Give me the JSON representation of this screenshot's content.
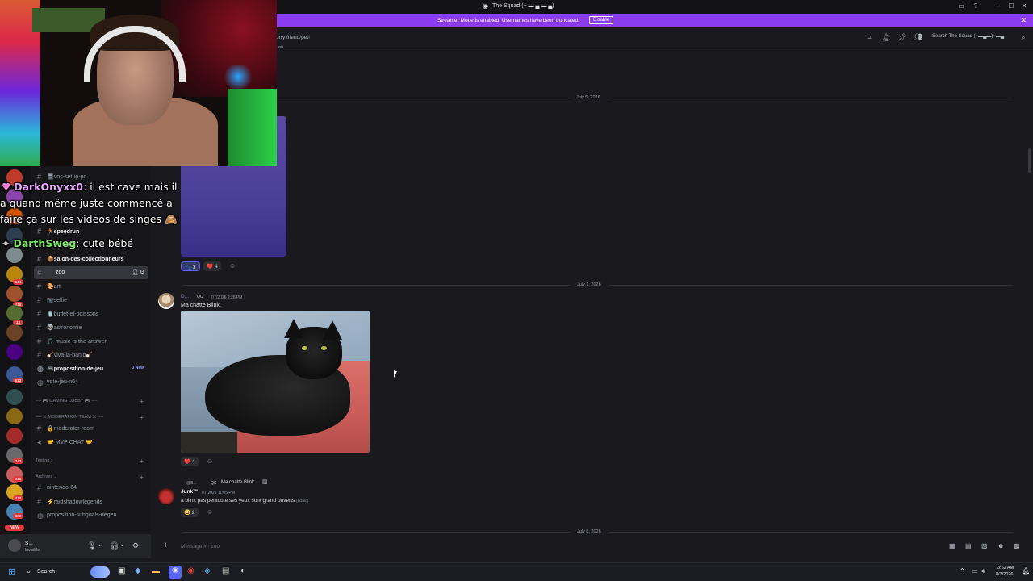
{
  "window": {
    "title": "The Squad (~ ▬ ▄ ▬ ▄)"
  },
  "banner": {
    "text": "Streamer Mode is enabled. Usernames have been truncated.",
    "disable_label": "Disable"
  },
  "header": {
    "topic": "urry friend/pet!",
    "search_placeholder": "Search The Squad (~▬▄▬)~▬▄"
  },
  "sidebar": {
    "channels_top": [
      {
        "name": "🖥vos-setup-pc"
      },
      {
        "name": "🏃speedrun",
        "bold": true
      },
      {
        "name": "📦salon-des-collectionneurs",
        "bold": true
      },
      {
        "name": "zoo",
        "active": true
      },
      {
        "name": "🎨art"
      },
      {
        "name": "📷selfie"
      },
      {
        "name": "🥤buffet-et-boissons"
      },
      {
        "name": "👽astronomie"
      },
      {
        "name": "🎵-music-is-the-answer"
      },
      {
        "name": "🪕viva-la-banjo🪕"
      },
      {
        "name": "🎮proposition-de-jeu",
        "bold": true,
        "badge": "3 New"
      },
      {
        "name": "vote-jeu-n64"
      }
    ],
    "cat_gaming": "---- 🎮 GAMING LOBBY 🎮 ----",
    "cat_moderation": "---- ⚔ MODERATION TEAM ⚔ ----",
    "moderation": [
      {
        "name": "🔒moderator-room"
      },
      {
        "name": "🤝 MVP CHAT 🤝"
      }
    ],
    "cat_testing": "Testing",
    "cat_archives": "Archives",
    "archives": [
      {
        "name": "nintendo-64"
      },
      {
        "name": "⚡raidshadowlegends"
      },
      {
        "name": "proposition-subgoals-degen"
      }
    ]
  },
  "rail_badges": [
    "644",
    "416",
    "18",
    "613",
    "343",
    "216",
    "429",
    "861"
  ],
  "rail_new": "NEW",
  "user": {
    "name": "S...",
    "status": "Invisible"
  },
  "chat": {
    "date1": "July 5, 2026",
    "msg0_reactions": [
      {
        "emoji": "🐾",
        "count": "3"
      },
      {
        "emoji": "❤️",
        "count": "4"
      }
    ],
    "date2": "July 1, 2026",
    "msg1": {
      "author": "D...",
      "tag": "QC",
      "time": "7/7/2026 2:26 PM",
      "text": "Ma chatte Blink.",
      "reaction_count": "4"
    },
    "reply": {
      "ref_author": "@B...",
      "ref_tag": "QC",
      "ref_text": "Ma chatte Blink.",
      "author": "Junk™",
      "time": "7/7/2026 11:05 PM",
      "text": "a blink pas pentoute ses yeux sont grand ouverts",
      "edited": "(edited)",
      "reaction_count": "2"
    },
    "date3": "July 8, 2026"
  },
  "composer": {
    "placeholder": "Message # ⋅ zoo"
  },
  "twitch": [
    {
      "user": "DarkOnyxx0",
      "text": " il est cave mais il",
      "line2": "a quand même juste commencé a",
      "line3": "faire ça sur les videos de singes"
    },
    {
      "user": "DarthSweg",
      "text": " cute bébé"
    }
  ],
  "taskbar": {
    "search": "Search",
    "time": "3:52 AM",
    "date": "8/3/2026"
  }
}
